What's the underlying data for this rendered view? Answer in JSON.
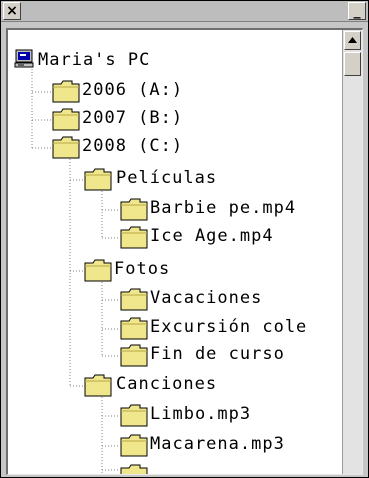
{
  "titlebar": {
    "close_label": "×",
    "minimize_label": "_"
  },
  "tree": {
    "root": {
      "label": "Maria's PC",
      "icon": "computer-icon"
    },
    "drives": [
      {
        "label": "2006 (A:)",
        "icon": "folder-icon"
      },
      {
        "label": "2007 (B:)",
        "icon": "folder-icon"
      },
      {
        "label": "2008 (C:)",
        "icon": "folder-icon"
      }
    ],
    "c_folders": [
      {
        "label": "Películas",
        "icon": "folder-icon",
        "children": [
          "Barbie pe.mp4",
          "Ice Age.mp4"
        ]
      },
      {
        "label": "Fotos",
        "icon": "folder-icon",
        "children": [
          "Vacaciones",
          "Excursión cole",
          "Fin de curso"
        ]
      },
      {
        "label": "Canciones",
        "icon": "folder-icon",
        "children": [
          "Limbo.mp3",
          "Macarena.mp3"
        ]
      }
    ]
  },
  "colors": {
    "folder_fill": "#f0e68c",
    "folder_stroke": "#000000",
    "tree_line": "#808080"
  }
}
